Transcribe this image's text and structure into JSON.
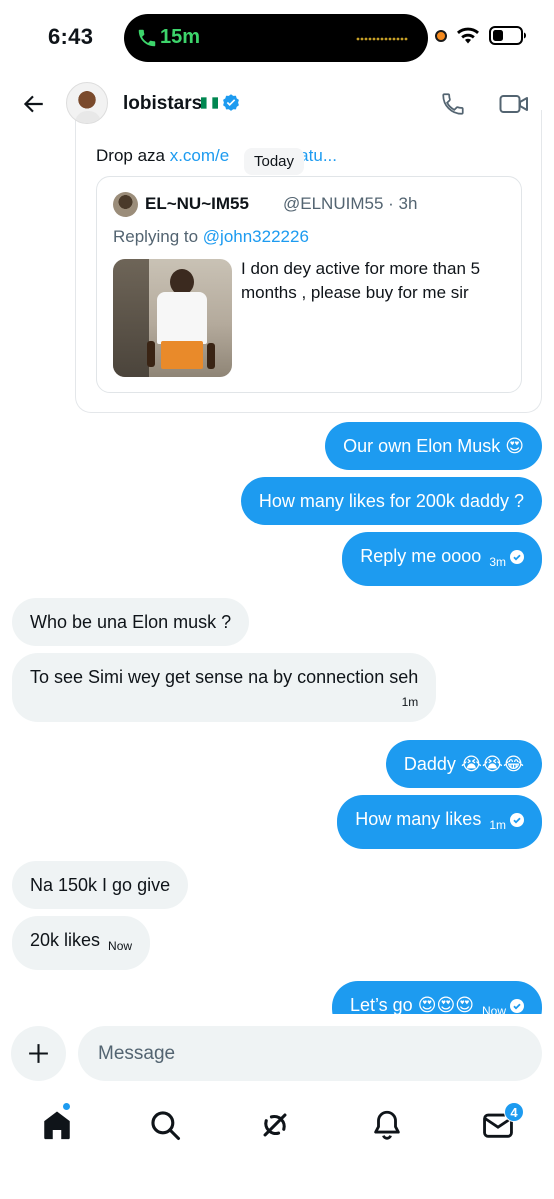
{
  "status_bar": {
    "time": "6:43",
    "call_duration": "15m",
    "accent_green": "#3dd56b",
    "recording_dot_color": "#f58a1e",
    "icons": [
      "phone-icon",
      "wifi-icon",
      "battery-icon"
    ]
  },
  "header": {
    "username": "lobistars",
    "flag": "nigeria-flag-icon",
    "verified": true,
    "icons": [
      "back-arrow-icon",
      "phone-icon",
      "video-camera-icon"
    ]
  },
  "shared_post": {
    "top_text": "Drop aza ",
    "top_link": "x.com/e",
    "top_link_tail": "/statu...",
    "date_divider": "Today",
    "author": "EL~NU~IM55",
    "handle_time": "@ELNUIM55 · 3h",
    "replying_prefix": "Replying to ",
    "replying_to": "@john322226",
    "text": "I don dey active for more than 5 months , please buy for me sir"
  },
  "messages": [
    {
      "side": "sent",
      "text": "Our own Elon Musk 😍",
      "time": ""
    },
    {
      "side": "sent",
      "text": "How many likes for 200k daddy ?",
      "time": ""
    },
    {
      "side": "sent",
      "text": "Reply me oooo",
      "time": "3m",
      "read": true
    },
    {
      "side": "received",
      "text": "Who be una Elon musk ?",
      "time": ""
    },
    {
      "side": "received",
      "text": "To see Simi wey get sense na by connection seh",
      "time": "1m"
    },
    {
      "side": "sent",
      "text": "Daddy 😭😭😂",
      "time": ""
    },
    {
      "side": "sent",
      "text": "How many likes",
      "time": "1m",
      "read": true
    },
    {
      "side": "received",
      "text": "Na 150k I go give",
      "time": ""
    },
    {
      "side": "received",
      "text": "20k likes",
      "time": "Now"
    },
    {
      "side": "sent",
      "text": "Let’s go 😍😍😍",
      "time": "Now",
      "read": true
    }
  ],
  "composer": {
    "placeholder": "Message",
    "plus_icon": "plus-icon"
  },
  "bottom_nav": {
    "items": [
      "home-icon",
      "search-icon",
      "grok-icon",
      "notifications-icon",
      "messages-icon"
    ],
    "messages_badge": "4",
    "accent": "#1d9bf0"
  }
}
